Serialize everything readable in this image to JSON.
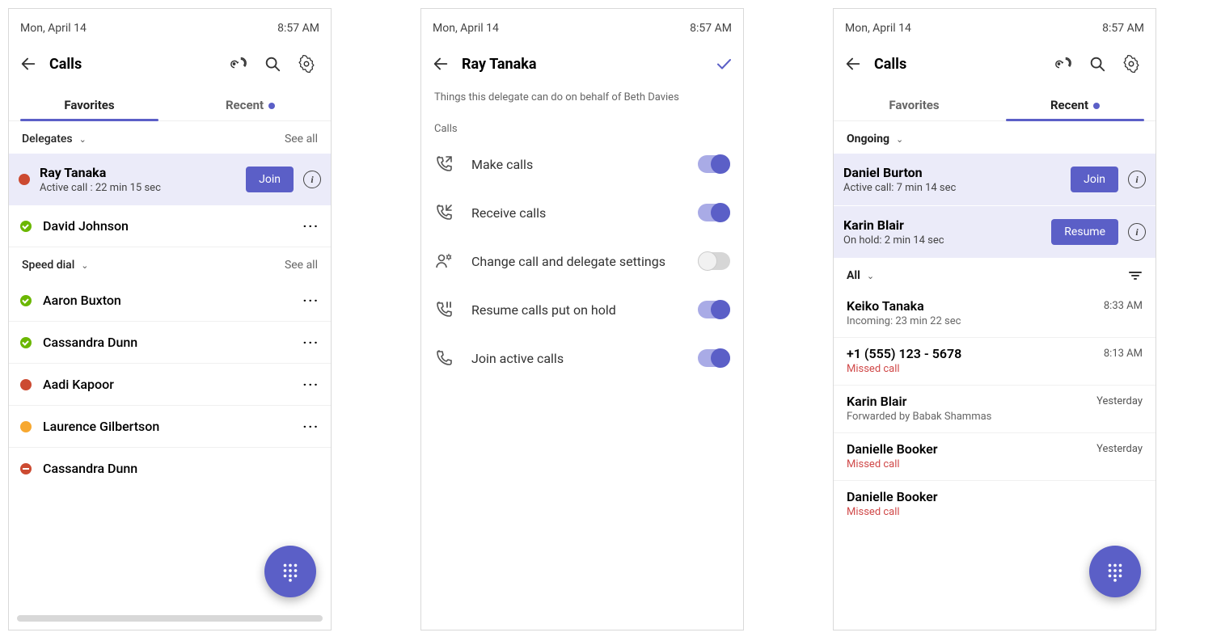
{
  "status": {
    "date": "Mon, April 14",
    "time": "8:57 AM"
  },
  "nav": {
    "calls_title": "Calls",
    "delegate_title": "Ray Tanaka",
    "tabs": {
      "favorites": "Favorites",
      "recent": "Recent"
    }
  },
  "pane1": {
    "sections": {
      "delegates": {
        "label": "Delegates",
        "see_all": "See all"
      },
      "speed_dial": {
        "label": "Speed dial",
        "see_all": "See all"
      }
    },
    "active_call": {
      "name": "Ray Tanaka",
      "sub": "Active call : 22 min 15 sec",
      "join": "Join"
    },
    "delegates_list": [
      {
        "name": "David Johnson",
        "presence": "avail"
      }
    ],
    "speed_dial_list": [
      {
        "name": "Aaron Buxton",
        "presence": "avail"
      },
      {
        "name": "Cassandra Dunn",
        "presence": "avail"
      },
      {
        "name": "Aadi Kapoor",
        "presence": "busy"
      },
      {
        "name": "Laurence Gilbertson",
        "presence": "away"
      },
      {
        "name": "Cassandra Dunn",
        "presence": "dnd"
      }
    ]
  },
  "pane2": {
    "subtitle": "Things this delegate can do on behalf of Beth Davies",
    "group": "Calls",
    "perms": [
      {
        "icon": "phone-out-icon",
        "label": "Make calls",
        "on": true
      },
      {
        "icon": "phone-in-icon",
        "label": "Receive calls",
        "on": true
      },
      {
        "icon": "settings-person-icon",
        "label": "Change call and delegate settings",
        "on": false
      },
      {
        "icon": "phone-pause-icon",
        "label": "Resume calls put on hold",
        "on": true
      },
      {
        "icon": "phone-icon",
        "label": "Join active calls",
        "on": true
      }
    ]
  },
  "pane3": {
    "ongoing_label": "Ongoing",
    "all_label": "All",
    "ongoing": [
      {
        "name": "Daniel Burton",
        "sub": "Active call: 7 min 14 sec",
        "btn": "Join"
      },
      {
        "name": "Karin Blair",
        "sub": "On hold: 2 min 14 sec",
        "btn": "Resume"
      }
    ],
    "recent": [
      {
        "name": "Keiko Tanaka",
        "sub": "Incoming: 23 min 22 sec",
        "time": "8:33 AM",
        "missed": false
      },
      {
        "name": "+1 (555) 123 - 5678",
        "sub": "Missed call",
        "time": "8:13 AM",
        "missed": true
      },
      {
        "name": "Karin Blair",
        "sub": "Forwarded by Babak Shammas",
        "time": "Yesterday",
        "missed": false
      },
      {
        "name": "Danielle Booker",
        "sub": "Missed call",
        "time": "Yesterday",
        "missed": true
      },
      {
        "name": "Danielle Booker",
        "sub": "Missed call",
        "time": "",
        "missed": true
      }
    ]
  }
}
